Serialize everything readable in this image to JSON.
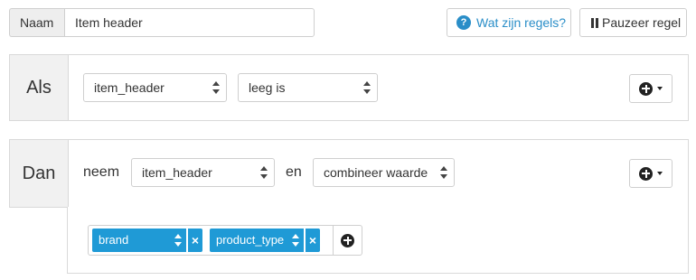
{
  "name_row": {
    "label": "Naam",
    "value": "Item header"
  },
  "toolbar": {
    "help_label": "Wat zijn regels?",
    "help_icon": "?",
    "pause_label": "Pauzeer regel"
  },
  "condition": {
    "label": "Als",
    "field": "item_header",
    "operator": "leeg is"
  },
  "action": {
    "label": "Dan",
    "verb": "neem",
    "field": "item_header",
    "connector": "en",
    "method": "combineer waarde",
    "tags": [
      {
        "label": "brand",
        "remove": "×"
      },
      {
        "label": "product_type",
        "remove": "×"
      }
    ]
  },
  "colors": {
    "accent": "#1f9ad6",
    "link": "#2a8ec8",
    "panel_label_bg": "#f1f1f1"
  }
}
